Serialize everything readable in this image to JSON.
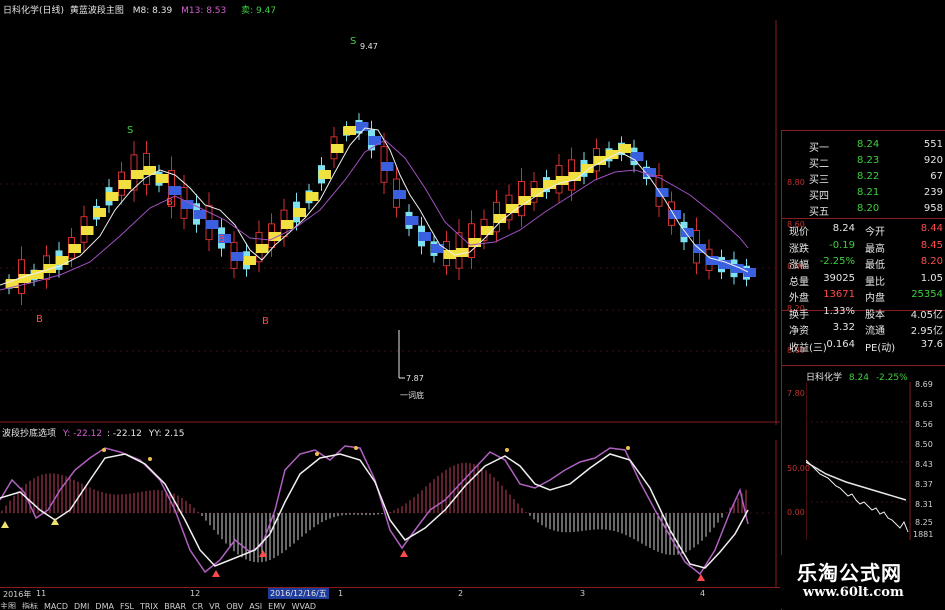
{
  "header": {
    "stock": "日科化学(日线)",
    "indicator": "黄蓝波段主图",
    "m8": "M8: 8.39",
    "m13": "M13: 8.53",
    "sell": "卖: 9.47"
  },
  "main_chart": {
    "price_axis": [
      "8.80",
      "8.60",
      "8.40",
      "8.20",
      "8.00",
      "7.80"
    ],
    "annot_high": "9.47",
    "annot_low": "7.87",
    "annot_low_label": "一词底",
    "signal_s": "S",
    "signal_b": "B"
  },
  "sub_chart": {
    "title": "波段抄底选项",
    "y_label": "Y: -22.12",
    "x_label": ": -22.12",
    "yy_label": "YY: 2.15",
    "axis": [
      "50.00",
      "0.00"
    ]
  },
  "quotes": {
    "rows": [
      {
        "label": "买一",
        "price": "8.24",
        "vol": "551"
      },
      {
        "label": "买二",
        "price": "8.23",
        "vol": "920"
      },
      {
        "label": "买三",
        "price": "8.22",
        "vol": "67"
      },
      {
        "label": "买四",
        "price": "8.21",
        "vol": "239"
      },
      {
        "label": "买五",
        "price": "8.20",
        "vol": "958"
      }
    ],
    "stats": [
      {
        "l1": "现价",
        "v1": "8.24",
        "l2": "今开",
        "v2": "8.44"
      },
      {
        "l1": "涨跌",
        "v1": "-0.19",
        "l2": "最高",
        "v2": "8.45"
      },
      {
        "l1": "涨幅",
        "v1": "-2.25%",
        "l2": "最低",
        "v2": "8.20"
      },
      {
        "l1": "总量",
        "v1": "39025",
        "l2": "量比",
        "v2": "1.05"
      },
      {
        "l1": "外盘",
        "v1": "13671",
        "l2": "内盘",
        "v2": "25354"
      },
      {
        "l1": "换手",
        "v1": "1.33%",
        "l2": "股本",
        "v2": "4.05亿"
      },
      {
        "l1": "净资",
        "v1": "3.32",
        "l2": "流通",
        "v2": "2.95亿"
      },
      {
        "l1": "收益(三)",
        "v1": "0.164",
        "l2": "PE(动)",
        "v2": "37.6"
      }
    ]
  },
  "mini_chart": {
    "name": "日科化学",
    "price": "8.24",
    "change": "-2.25%",
    "axis": [
      "8.69",
      "8.63",
      "8.56",
      "8.50",
      "8.43",
      "8.37",
      "8.31",
      "8.25"
    ],
    "vol_label": "1881"
  },
  "time_axis": {
    "year": "2016年",
    "m11": "11",
    "m12": "12",
    "date": "2016/12/16/五",
    "m1": "1",
    "m2": "2",
    "m3": "3",
    "m4": "4"
  },
  "bottom_tabs": [
    "主图",
    "指标",
    "MACD",
    "DMI",
    "DMA",
    "FSL",
    "TRIX",
    "BRAR",
    "CR",
    "VR",
    "OBV",
    "ASI",
    "EMV",
    "WVAD"
  ],
  "watermark": {
    "line1": "乐淘公式网",
    "line2": "www.60lt.com"
  }
}
